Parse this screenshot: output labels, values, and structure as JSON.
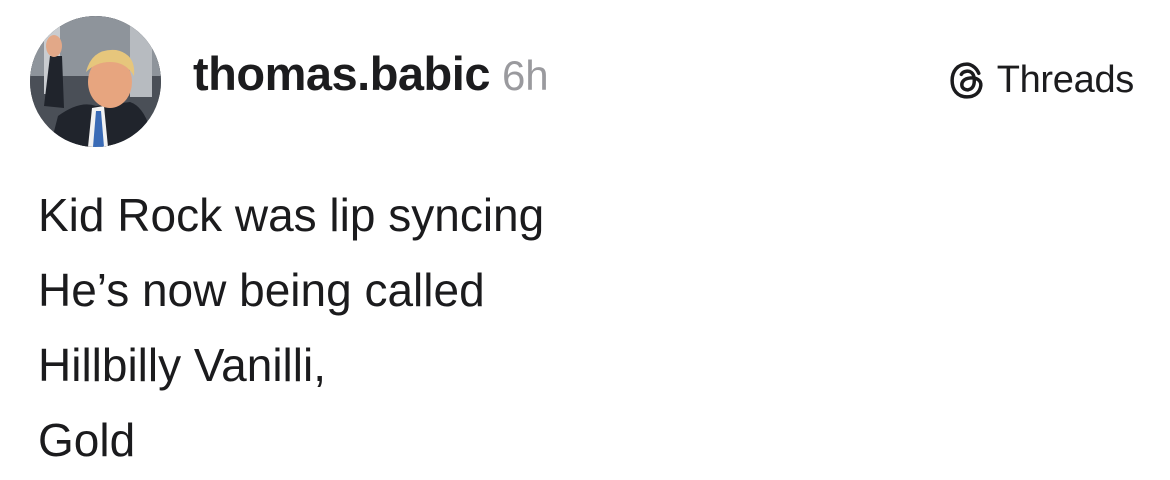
{
  "post": {
    "author": {
      "username": "thomas.babic",
      "avatar_icon": "profile-photo"
    },
    "timestamp": "6h",
    "brand": {
      "label": "Threads",
      "icon": "threads-logo-icon"
    },
    "lines": [
      "Kid Rock was lip syncing",
      "He’s now being called",
      "Hillbilly Vanilli,",
      "Gold"
    ]
  },
  "colors": {
    "text": "#1b1b1d",
    "timestamp": "#9a9a9e",
    "background": "#ffffff"
  }
}
